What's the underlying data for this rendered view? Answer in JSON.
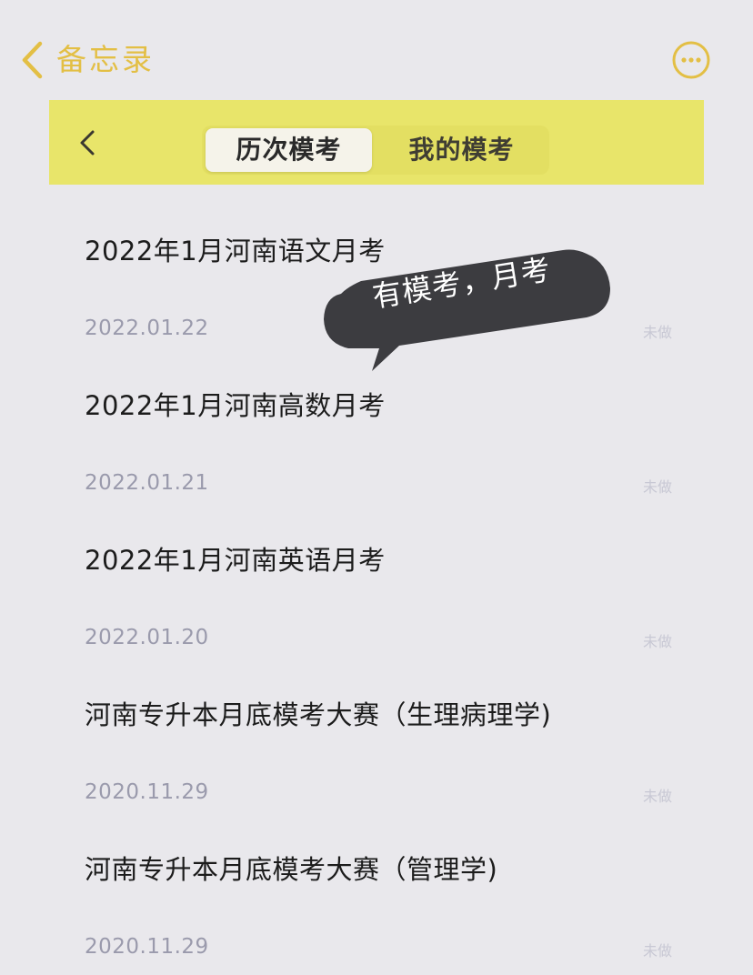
{
  "notes_nav": {
    "back_label": "备忘录",
    "back_icon": "chevron-left-icon",
    "more_icon": "ellipsis-circle-icon"
  },
  "app_header": {
    "back_icon": "chevron-left-icon",
    "tabs": [
      {
        "label": "历次模考",
        "active": true
      },
      {
        "label": "我的模考",
        "active": false
      }
    ]
  },
  "exams": [
    {
      "title": "2022年1月河南语文月考",
      "date": "2022.01.22",
      "status": "未做"
    },
    {
      "title": "2022年1月河南高数月考",
      "date": "2022.01.21",
      "status": "未做"
    },
    {
      "title": "2022年1月河南英语月考",
      "date": "2022.01.20",
      "status": "未做"
    },
    {
      "title": "河南专升本月底模考大赛（生理病理学)",
      "date": "2020.11.29",
      "status": "未做"
    },
    {
      "title": "河南专升本月底模考大赛（管理学)",
      "date": "2020.11.29",
      "status": "未做"
    }
  ],
  "overlay": {
    "bubble_text": "有模考，月考"
  },
  "colors": {
    "background": "#e9e8ec",
    "header_yellow": "#e8e56a",
    "accent_gold": "#e3bf45",
    "bubble": "#3c3c40"
  }
}
